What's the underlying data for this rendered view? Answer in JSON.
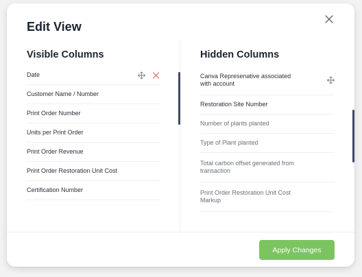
{
  "dialog": {
    "title": "Edit View",
    "close_icon": "close-icon"
  },
  "visible_columns": {
    "heading": "Visible Columns",
    "items": [
      {
        "label": "Date",
        "actions": [
          "move-icon",
          "remove-icon"
        ]
      },
      {
        "label": "Customer Name / Number"
      },
      {
        "label": "Print Order Number"
      },
      {
        "label": "Units per Print Order"
      },
      {
        "label": "Print Order Revenue"
      },
      {
        "label": "Print Order Restoration Unit Cost"
      },
      {
        "label": "Certification Number"
      }
    ]
  },
  "hidden_columns": {
    "heading": "Hidden Columns",
    "items": [
      {
        "label": "Canva Represenative associated with account",
        "actions": [
          "move-icon"
        ]
      },
      {
        "label": "Restoration Site Number"
      },
      {
        "label": "Number of plants planted"
      },
      {
        "label": "Type of Plant planted"
      },
      {
        "label": "Total carbon offset generated from transaction"
      },
      {
        "label": "Print Order Restoration Unit Cost Markup"
      }
    ]
  },
  "footer": {
    "apply_label": "Apply Changes"
  },
  "colors": {
    "accent_green": "#7cc45f",
    "remove_red": "#e0584f",
    "scrollbar": "#3f4a66"
  }
}
